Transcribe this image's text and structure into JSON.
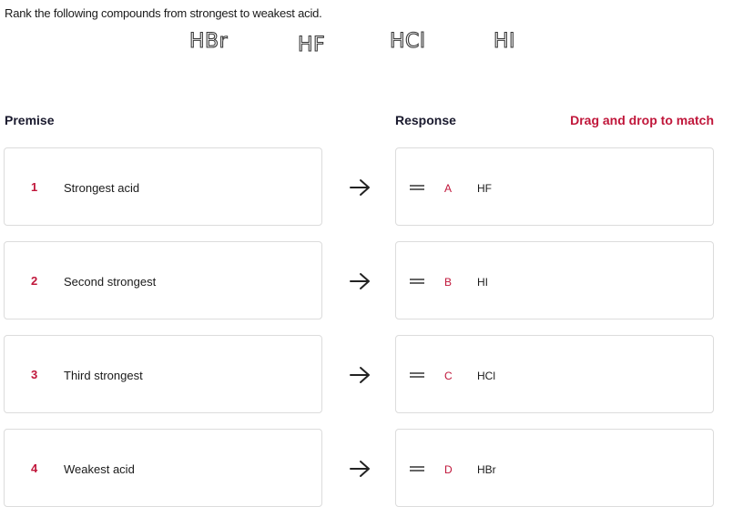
{
  "question": "Rank the following compounds from strongest to weakest acid.",
  "formulas": [
    "HBr",
    "HF",
    "HCl",
    "HI"
  ],
  "headers": {
    "premise": "Premise",
    "response": "Response",
    "instruction": "Drag and drop to match"
  },
  "premises": [
    {
      "number": "1",
      "label": "Strongest acid"
    },
    {
      "number": "2",
      "label": "Second strongest"
    },
    {
      "number": "3",
      "label": "Third strongest"
    },
    {
      "number": "4",
      "label": "Weakest acid"
    }
  ],
  "responses": [
    {
      "letter": "A",
      "value": "HF"
    },
    {
      "letter": "B",
      "value": "HI"
    },
    {
      "letter": "C",
      "value": "HCl"
    },
    {
      "letter": "D",
      "value": "HBr"
    }
  ],
  "icons": {
    "arrow": "arrow-right-icon",
    "handle": "drag-handle-icon"
  },
  "colors": {
    "accent": "#c0163a"
  }
}
